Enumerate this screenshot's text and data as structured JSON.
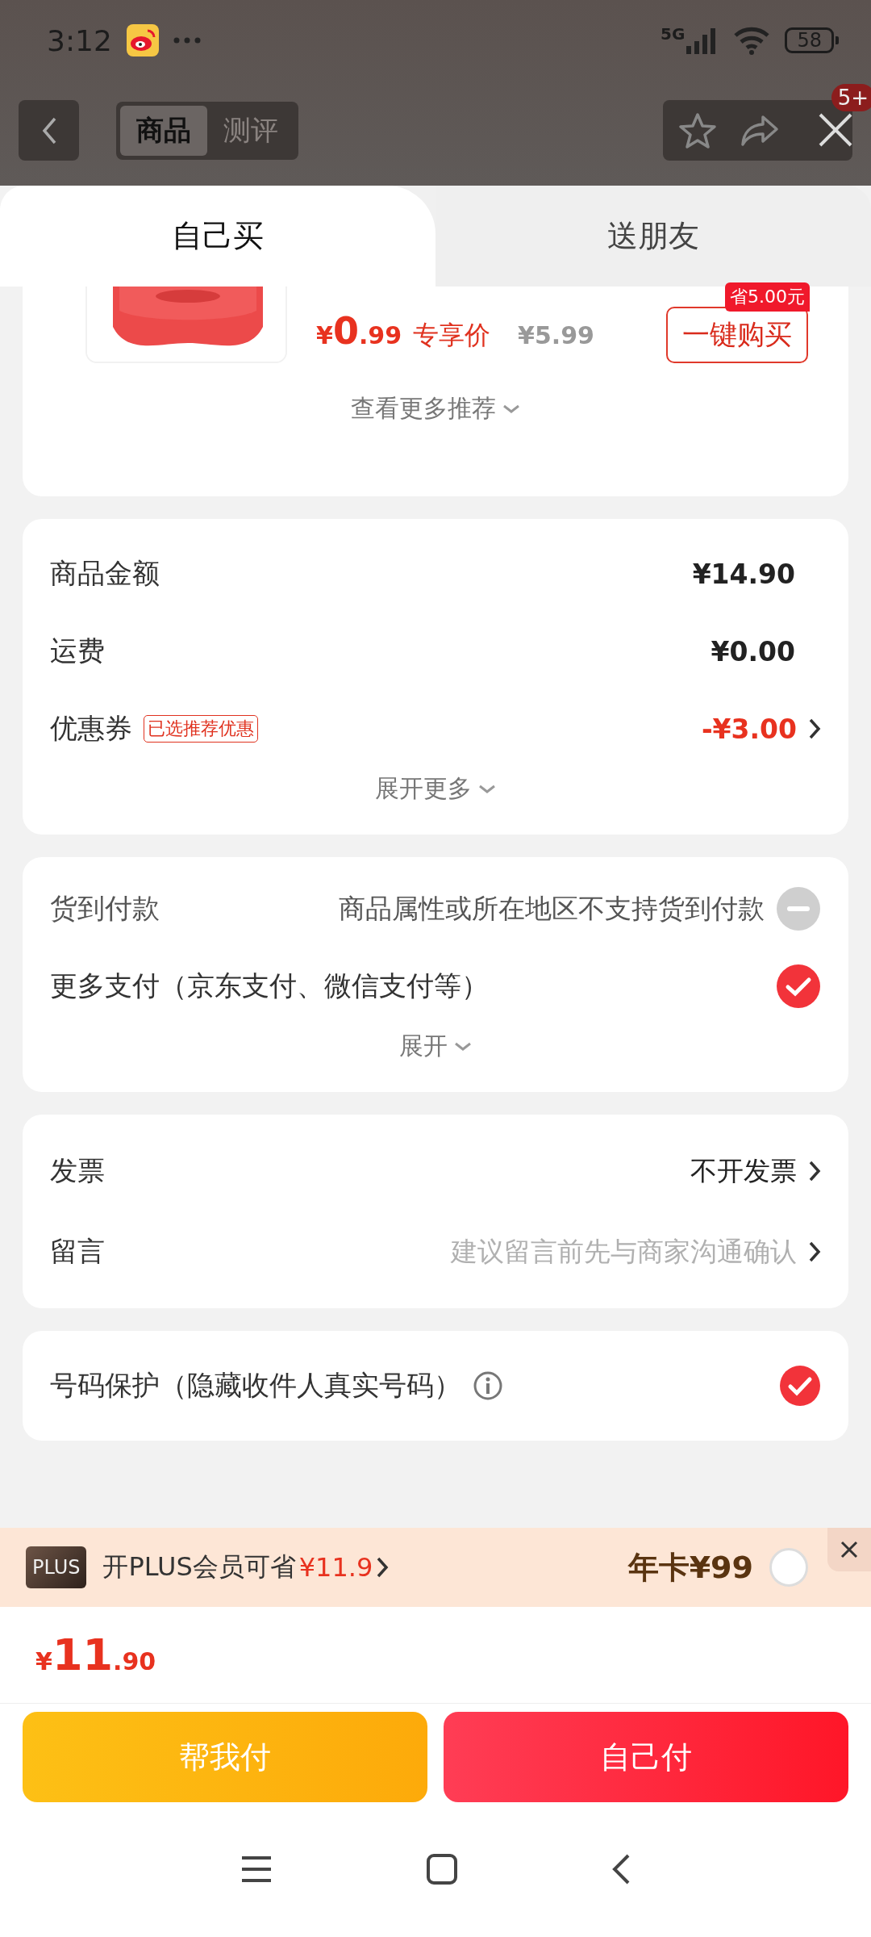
{
  "status_bar": {
    "time": "3:12",
    "network": "5G",
    "battery": "58"
  },
  "nav": {
    "tabs": [
      {
        "label": "商品",
        "selected": true
      },
      {
        "label": "测评",
        "selected": false
      }
    ],
    "badge": "5+"
  },
  "sheet_tabs": [
    {
      "label": "自己买",
      "selected": true
    },
    {
      "label": "送朋友",
      "selected": false
    }
  ],
  "recommend": {
    "currency": "¥",
    "price_integer": "0",
    "price_decimal": ".99",
    "price_tag": "专享价",
    "original_price": "¥5.99",
    "save_badge": "省5.00元",
    "buy_button": "一键购买",
    "more": "查看更多推荐"
  },
  "summary": {
    "rows": [
      {
        "label": "商品金额",
        "value": "¥14.90",
        "kind": "plain",
        "arrow": false
      },
      {
        "label": "运费",
        "value": "¥0.00",
        "kind": "plain",
        "arrow": false
      },
      {
        "label": "优惠券",
        "tag": "已选推荐优惠",
        "value": "-¥3.00",
        "kind": "discount",
        "arrow": true
      }
    ],
    "more": "展开更多"
  },
  "payment": {
    "options": [
      {
        "label": "货到付款",
        "note": "商品属性或所在地区不支持货到付款",
        "disabled": true,
        "checked": false
      },
      {
        "label": "更多支付（京东支付、微信支付等）",
        "disabled": false,
        "checked": true
      }
    ],
    "more": "展开"
  },
  "extras": {
    "rows": [
      {
        "label": "发票",
        "value": "不开发票",
        "kind": "value"
      },
      {
        "label": "留言",
        "placeholder": "建议留言前先与商家沟通确认",
        "kind": "placeholder"
      }
    ]
  },
  "privacy": {
    "label": "号码保护（隐藏收件人真实号码）",
    "checked": true
  },
  "plus": {
    "badge": "PLUS",
    "text": "开PLUS会员可省",
    "saving": "¥11.9",
    "annual": "年卡¥99",
    "selected": false
  },
  "total": {
    "currency": "¥",
    "integer": "11",
    "decimal": ".90"
  },
  "buttons": [
    {
      "label": "帮我付",
      "kind": "help"
    },
    {
      "label": "自己付",
      "kind": "self"
    }
  ]
}
